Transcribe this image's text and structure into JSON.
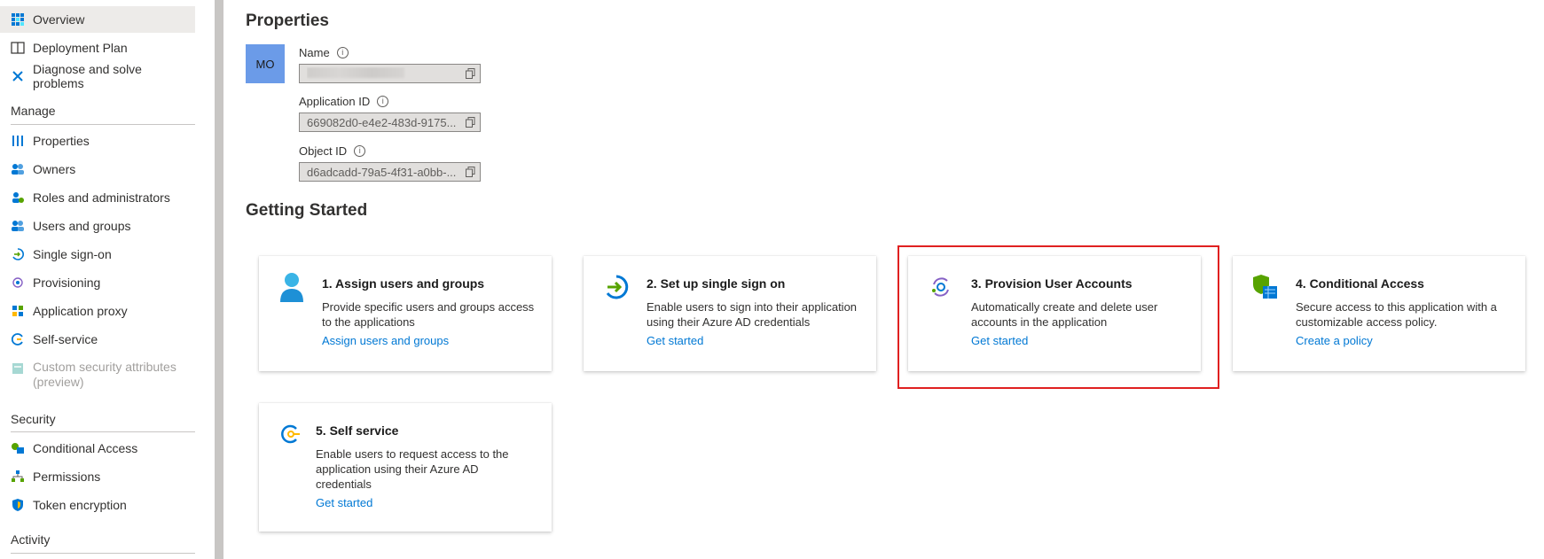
{
  "sidebar": {
    "items_top": [
      {
        "label": "Overview",
        "icon": "overview-grid-icon"
      },
      {
        "label": "Deployment Plan",
        "icon": "book-icon"
      },
      {
        "label": "Diagnose and solve problems",
        "icon": "wrench-icon"
      }
    ],
    "manage_title": "Manage",
    "manage_items": [
      {
        "label": "Properties",
        "icon": "properties-bars-icon"
      },
      {
        "label": "Owners",
        "icon": "owners-icon"
      },
      {
        "label": "Roles and administrators",
        "icon": "roles-icon"
      },
      {
        "label": "Users and groups",
        "icon": "users-icon"
      },
      {
        "label": "Single sign-on",
        "icon": "single-sign-on-icon"
      },
      {
        "label": "Provisioning",
        "icon": "provisioning-icon"
      },
      {
        "label": "Application proxy",
        "icon": "application-proxy-icon"
      },
      {
        "label": "Self-service",
        "icon": "self-service-icon"
      },
      {
        "label": "Custom security attributes\n(preview)",
        "icon": "custom-attributes-icon"
      }
    ],
    "security_title": "Security",
    "security_items": [
      {
        "label": "Conditional Access",
        "icon": "conditional-access-icon"
      },
      {
        "label": "Permissions",
        "icon": "permissions-icon"
      },
      {
        "label": "Token encryption",
        "icon": "shield-icon"
      }
    ],
    "activity_title": "Activity"
  },
  "properties": {
    "title": "Properties",
    "avatar_initials": "MO",
    "name_label": "Name",
    "name_value": "",
    "app_id_label": "Application ID",
    "app_id_value": "669082d0-e4e2-483d-9175...",
    "object_id_label": "Object ID",
    "object_id_value": "d6adcadd-79a5-4f31-a0bb-..."
  },
  "getting_started": {
    "title": "Getting Started",
    "cards": [
      {
        "title": "1. Assign users and groups",
        "desc": "Provide specific users and groups access to the applications",
        "link": "Assign users and groups"
      },
      {
        "title": "2. Set up single sign on",
        "desc": "Enable users to sign into their application using their Azure AD credentials",
        "link": "Get started"
      },
      {
        "title": "3. Provision User Accounts",
        "desc": "Automatically create and delete user accounts in the application",
        "link": "Get started"
      },
      {
        "title": "4. Conditional Access",
        "desc": "Secure access to this application with a customizable access policy.",
        "link": "Create a policy"
      },
      {
        "title": "5. Self service",
        "desc": "Enable users to request access to the application using their Azure AD credentials",
        "link": "Get started"
      }
    ]
  },
  "colors": {
    "accent": "#0078d4",
    "highlight": "#e02020",
    "avatar": "#6b9be8"
  }
}
